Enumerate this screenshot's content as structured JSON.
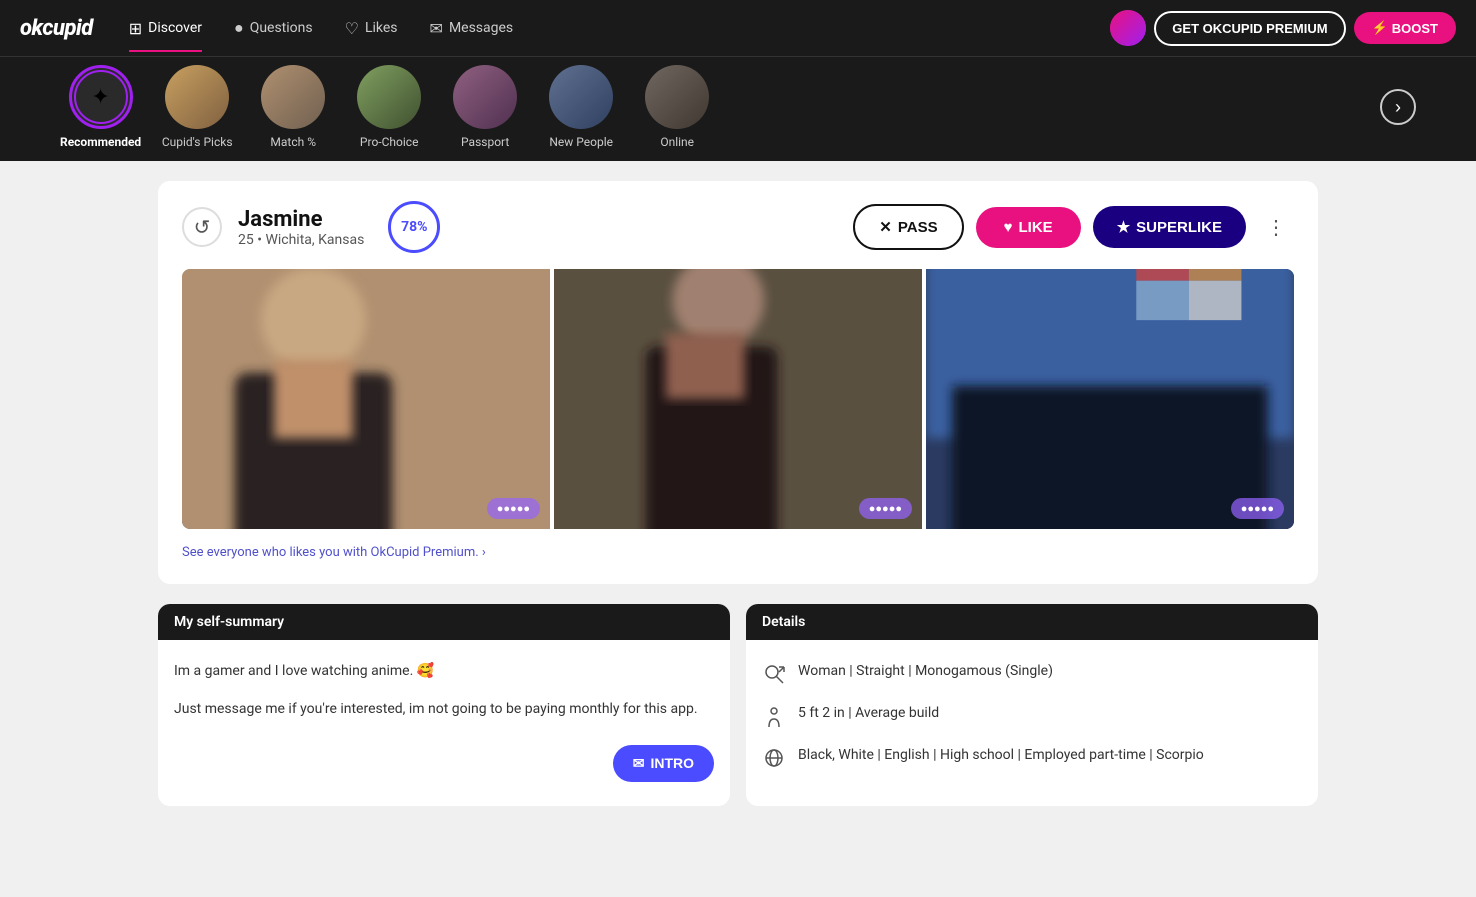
{
  "app": {
    "logo": "okcupid",
    "nav": {
      "items": [
        {
          "id": "discover",
          "label": "Discover",
          "icon": "⊞",
          "active": true
        },
        {
          "id": "questions",
          "label": "Questions",
          "icon": "?"
        },
        {
          "id": "likes",
          "label": "Likes",
          "icon": "♡"
        },
        {
          "id": "messages",
          "label": "Messages",
          "icon": "✉"
        }
      ]
    },
    "premium_btn": "GET OKCUPID PREMIUM",
    "boost_btn": "⚡ BOOST"
  },
  "categories": [
    {
      "id": "recommended",
      "label": "Recommended",
      "active": true,
      "icon": "✦"
    },
    {
      "id": "cupids-picks",
      "label": "Cupid's Picks"
    },
    {
      "id": "match",
      "label": "Match %"
    },
    {
      "id": "pro-choice",
      "label": "Pro-Choice"
    },
    {
      "id": "passport",
      "label": "Passport"
    },
    {
      "id": "new-people",
      "label": "New People"
    },
    {
      "id": "online",
      "label": "Online"
    }
  ],
  "profile": {
    "name": "Jasmine",
    "age": 25,
    "location": "Wichita, Kansas",
    "match_pct": "78%",
    "photos": [
      {
        "id": 1,
        "alt": "Photo 1"
      },
      {
        "id": 2,
        "alt": "Photo 2"
      },
      {
        "id": 3,
        "alt": "Photo 3"
      }
    ],
    "premium_link": "See everyone who likes you with OkCupid Premium. ›",
    "summary": {
      "header": "My self-summary",
      "paragraphs": [
        "Im a gamer and I love watching anime. 🥰",
        "Just message me if you're interested, im not going to be paying monthly for this app."
      ]
    },
    "details": {
      "header": "Details",
      "items": [
        {
          "icon": "gender",
          "text": "Woman | Straight | Monogamous (Single)"
        },
        {
          "icon": "height",
          "text": "5 ft 2 in | Average build"
        },
        {
          "icon": "globe",
          "text": "Black, White | English | High school | Employed part-time | Scorpio"
        }
      ]
    }
  },
  "actions": {
    "pass": "PASS",
    "like": "LIKE",
    "superlike": "SUPERLIKE",
    "intro": "INTRO",
    "undo_tooltip": "Undo"
  }
}
